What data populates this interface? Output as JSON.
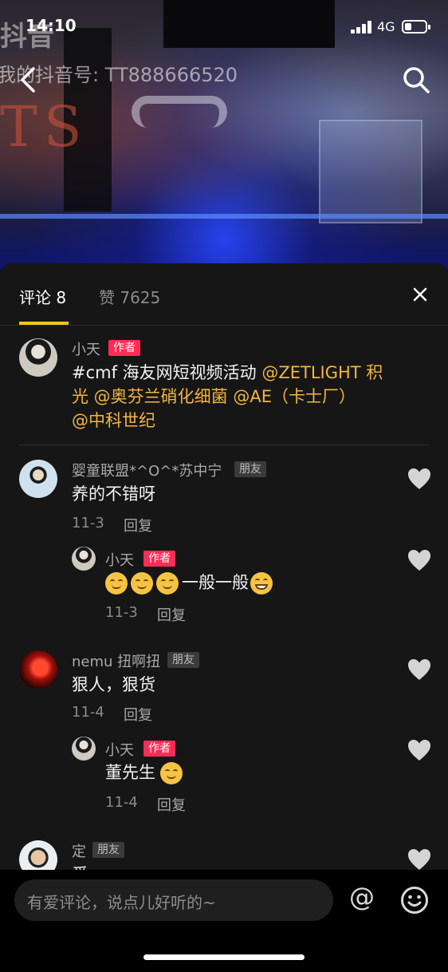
{
  "status_bar": {
    "time": "14:10",
    "network": "4G",
    "battery_percent": 35
  },
  "video": {
    "logo_text": "抖音",
    "watermark_id": "我的抖音号: TT888666520",
    "back_icon": "chevron-left-icon",
    "search_icon": "search-icon"
  },
  "panel": {
    "tab_comments": "评论 8",
    "tab_likes": "赞 7625",
    "close_icon": "close-icon"
  },
  "comments": [
    {
      "author": "小天",
      "badge": "作者",
      "text_prefix": "#cmf 海友网短视频活动 ",
      "mention1": "@ZETLIGHT 积",
      "mention1b": "光 @奥芬兰硝化细菌 @AE（卡士厂）",
      "mention2": "@中科世纪"
    },
    {
      "author": "婴童联盟*^O^*苏中宁",
      "badge": "朋友",
      "text": "养的不错呀",
      "date": "11-3",
      "reply": "回复",
      "replies": [
        {
          "author": "小天",
          "badge": "作者",
          "text": "一般一般",
          "date": "11-3",
          "reply": "回复"
        }
      ]
    },
    {
      "author": "nemu 扭啊扭",
      "badge": "朋友",
      "text": "狠人，狠货",
      "date": "11-4",
      "reply": "回复",
      "replies": [
        {
          "author": "小天",
          "badge": "作者",
          "text": "董先生",
          "date": "11-4",
          "reply": "回复"
        }
      ]
    },
    {
      "author": "定",
      "badge": "朋友",
      "text": "爱"
    }
  ],
  "input": {
    "placeholder": "有爱评论，说点儿好听的~",
    "at_symbol": "@",
    "emoji_icon": "smiley-icon"
  }
}
